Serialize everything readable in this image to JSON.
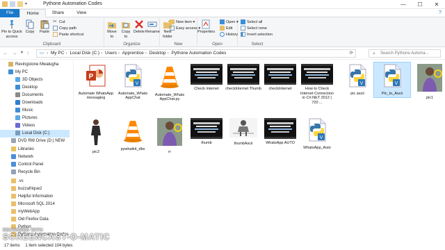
{
  "window": {
    "title": "Pythone Automation Codes",
    "minimize": "—",
    "maximize": "☐",
    "close": "✕",
    "help": "?"
  },
  "tabs": [
    {
      "label": "File"
    },
    {
      "label": "Home"
    },
    {
      "label": "Share"
    },
    {
      "label": "View"
    }
  ],
  "ribbon": {
    "clipboard": {
      "label": "Clipboard",
      "pin": "Pin to Quick access",
      "copy": "Copy",
      "paste": "Paste",
      "cut": "Cut",
      "copy_path": "Copy path",
      "paste_shortcut": "Paste shortcut"
    },
    "organize": {
      "label": "Organize",
      "move_to": "Move to",
      "copy_to": "Copy to",
      "delete": "Delete",
      "rename": "Rename"
    },
    "new": {
      "label": "New",
      "new_folder": "New folder",
      "new_item": "New item ▾",
      "easy_access": "Easy access ▾"
    },
    "open": {
      "label": "Open",
      "properties": "Properties",
      "open": "Open ▾",
      "edit": "Edit",
      "history": "History"
    },
    "select": {
      "label": "Select",
      "select_all": "Select all",
      "select_none": "Select none",
      "invert": "Invert selection"
    }
  },
  "address": {
    "crumbs": [
      "My PC",
      "Local Disk (C:)",
      "Users",
      "Apprentice",
      "Desktop",
      "Pythone Automation Codes"
    ],
    "search_placeholder": "Search Pythone Automa..."
  },
  "sidebar": [
    {
      "label": "Revingstone Mwalugha",
      "icon": "user-icon",
      "color": "#d9b36a"
    },
    {
      "label": "My PC",
      "icon": "pc-icon",
      "color": "#3b8fd9"
    },
    {
      "label": "3D Objects",
      "icon": "cube-icon",
      "color": "#5aa9e6"
    },
    {
      "label": "Desktop",
      "icon": "desktop-icon",
      "color": "#3b8fd9"
    },
    {
      "label": "Documents",
      "icon": "document-icon",
      "color": "#8a8a8a"
    },
    {
      "label": "Downloads",
      "icon": "download-icon",
      "color": "#2f7fd1"
    },
    {
      "label": "Music",
      "icon": "music-icon",
      "color": "#3b8fd9"
    },
    {
      "label": "Pictures",
      "icon": "pictures-icon",
      "color": "#5aa9e6"
    },
    {
      "label": "Videos",
      "icon": "video-icon",
      "color": "#6b6bd1"
    },
    {
      "label": "Local Disk (C:)",
      "icon": "disk-icon",
      "color": "#7a9cbf"
    },
    {
      "label": "DVD RW Drive (D:) NEW",
      "icon": "dvd-icon",
      "color": "#9aa5b1"
    },
    {
      "label": "Libraries",
      "icon": "library-icon",
      "color": "#e6c35c"
    },
    {
      "label": "Network",
      "icon": "network-icon",
      "color": "#4c8ed9"
    },
    {
      "label": "Control Panel",
      "icon": "control-panel-icon",
      "color": "#4c8ed9"
    },
    {
      "label": "Recycle Bin",
      "icon": "recycle-bin-icon",
      "color": "#8fa3b8"
    },
    {
      "label": ".vs",
      "icon": "folder-icon",
      "color": "#e8c06a"
    },
    {
      "label": "buzzafrique2",
      "icon": "folder-icon",
      "color": "#e8c06a"
    },
    {
      "label": "Helpful Information",
      "icon": "folder-icon",
      "color": "#e8c06a"
    },
    {
      "label": "Microsoft SQL 2014",
      "icon": "folder-icon",
      "color": "#e8c06a"
    },
    {
      "label": "myWebApp",
      "icon": "folder-icon",
      "color": "#e8c06a"
    },
    {
      "label": "Old Firefox Data",
      "icon": "folder-icon",
      "color": "#e8c06a"
    },
    {
      "label": "Python",
      "icon": "folder-icon",
      "color": "#e8c06a"
    },
    {
      "label": "Pythone Automation Codes",
      "icon": "folder-icon",
      "color": "#e8c06a"
    }
  ],
  "files": [
    {
      "label": "Automate WhatsApp messaging",
      "kind": "powerpoint"
    },
    {
      "label": "Automate_Whats AppChat",
      "kind": "python"
    },
    {
      "label": "Automate_Whats AppChat.py",
      "kind": "vlc"
    },
    {
      "label": "Check internet",
      "kind": "video"
    },
    {
      "label": "checkInternet Thumb",
      "kind": "video"
    },
    {
      "label": "checkInternet",
      "kind": "video"
    },
    {
      "label": "How to Check Internet Connection in C#.NET 2012 ( 720 ...",
      "kind": "video"
    },
    {
      "label": "pic ascii",
      "kind": "python"
    },
    {
      "label": "Pic_to_Ascii",
      "kind": "python"
    },
    {
      "label": "pic1",
      "kind": "photo"
    },
    {
      "label": "pic2",
      "kind": "person"
    },
    {
      "label": "pywhatkit_dbs",
      "kind": "vlc"
    },
    {
      "label": "rr",
      "kind": "photo"
    },
    {
      "label": "thumb",
      "kind": "video"
    },
    {
      "label": "thumbAscii",
      "kind": "ascii"
    },
    {
      "label": "WhatsApp AUTO",
      "kind": "video"
    },
    {
      "label": "WhatsApp_Auto",
      "kind": "python"
    }
  ],
  "status": {
    "items": "17 items",
    "selected": "1 item selected  104 bytes"
  },
  "watermark": {
    "line1": "RECORDED WITH",
    "line2": "SCREENCAST-O-MATIC"
  },
  "colors": {
    "accent": "#1979ca",
    "selection": "#cce8ff",
    "folder": "#e8c06a"
  }
}
